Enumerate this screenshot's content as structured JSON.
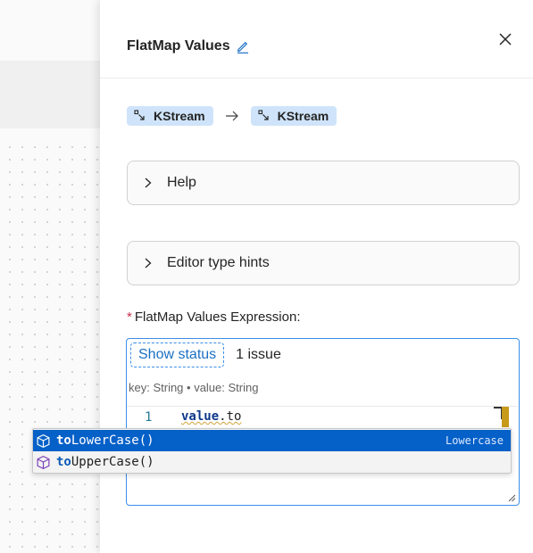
{
  "panel": {
    "title": "FlatMap Values",
    "chips": {
      "input": "KStream",
      "output": "KStream"
    },
    "accordions": {
      "help": "Help",
      "type_hints": "Editor type hints"
    },
    "field": {
      "required_mark": "*",
      "label": "FlatMap Values Expression:"
    },
    "editor": {
      "show_status": "Show status",
      "issues": "1 issue",
      "type_hint": "key: String • value: String",
      "line_number": "1",
      "code_var": "value",
      "code_rest": ".to"
    }
  },
  "suggestions": [
    {
      "match": "to",
      "rest": "LowerCase()",
      "detail": "Lowercase",
      "selected": true
    },
    {
      "match": "to",
      "rest": "UpperCase()",
      "detail": "",
      "selected": false
    }
  ],
  "colors": {
    "accent": "#3b8ee8",
    "chip_bg": "#cfe4fa",
    "selection": "#0560c8",
    "required": "#c4314b"
  }
}
